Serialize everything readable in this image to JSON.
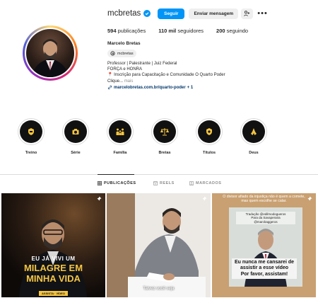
{
  "profile": {
    "username": "mcbretas",
    "follow_label": "Seguir",
    "message_label": "Enviar mensagem",
    "add_user_icon": "person-add-icon",
    "more_icon": "ellipsis-icon",
    "stats": [
      {
        "count": "594",
        "label": "publicações"
      },
      {
        "count": "110 mil",
        "label": "seguidores"
      },
      {
        "count": "200",
        "label": "seguindo"
      }
    ],
    "full_name": "Marcelo Bretas",
    "threads_handle": "mcbretas",
    "bio_lines": [
      "Professor | Palestrante | Juiz Federal",
      "FORÇA e HONRA",
      "Inscrição para Capacitação e Comunidade O Quarto Poder",
      "Clique...",
      "mais"
    ],
    "link": "marcelobretas.com.br/quarto-poder",
    "link_extra": "+ 1"
  },
  "highlights": [
    {
      "label": "Treino",
      "icon": "crest-icon"
    },
    {
      "label": "Série",
      "icon": "camera-icon"
    },
    {
      "label": "Família",
      "icon": "family-icon"
    },
    {
      "label": "Bretas",
      "icon": "scales-icon"
    },
    {
      "label": "Títulos",
      "icon": "badge-icon"
    },
    {
      "label": "Deus",
      "icon": "praying-hands-icon"
    }
  ],
  "tabs": [
    {
      "label": "PUBLICAÇÕES",
      "icon": "grid-icon",
      "active": true
    },
    {
      "label": "REELS",
      "icon": "reels-icon",
      "active": false
    },
    {
      "label": "MARCADOS",
      "icon": "tagged-icon",
      "active": false
    }
  ],
  "posts": [
    {
      "line1": "EU JÁ VIVI UM",
      "line2": "MILAGRE EM",
      "line3": "MINHA VIDA",
      "footer": "ASSISTA · VÍDEO",
      "pinned": true
    },
    {
      "caption": "Talvez você seja",
      "pinned": true
    },
    {
      "top_text": "O divisor afiado da injustiça não é quem a comete, mas quem escolhe se calar.",
      "title_box": "Tradução @edilmodogueros\nPara da Savaperaira\n@marcbaggeros",
      "main_text": "Eu nunca me cansarei de assistir a esse vídeo\nPor favor, assistam!",
      "pinned": true
    }
  ],
  "colors": {
    "primary": "#0095f6",
    "link": "#00376b",
    "text": "#262626",
    "muted": "#8e8e8e",
    "gold": "#f5c542"
  }
}
